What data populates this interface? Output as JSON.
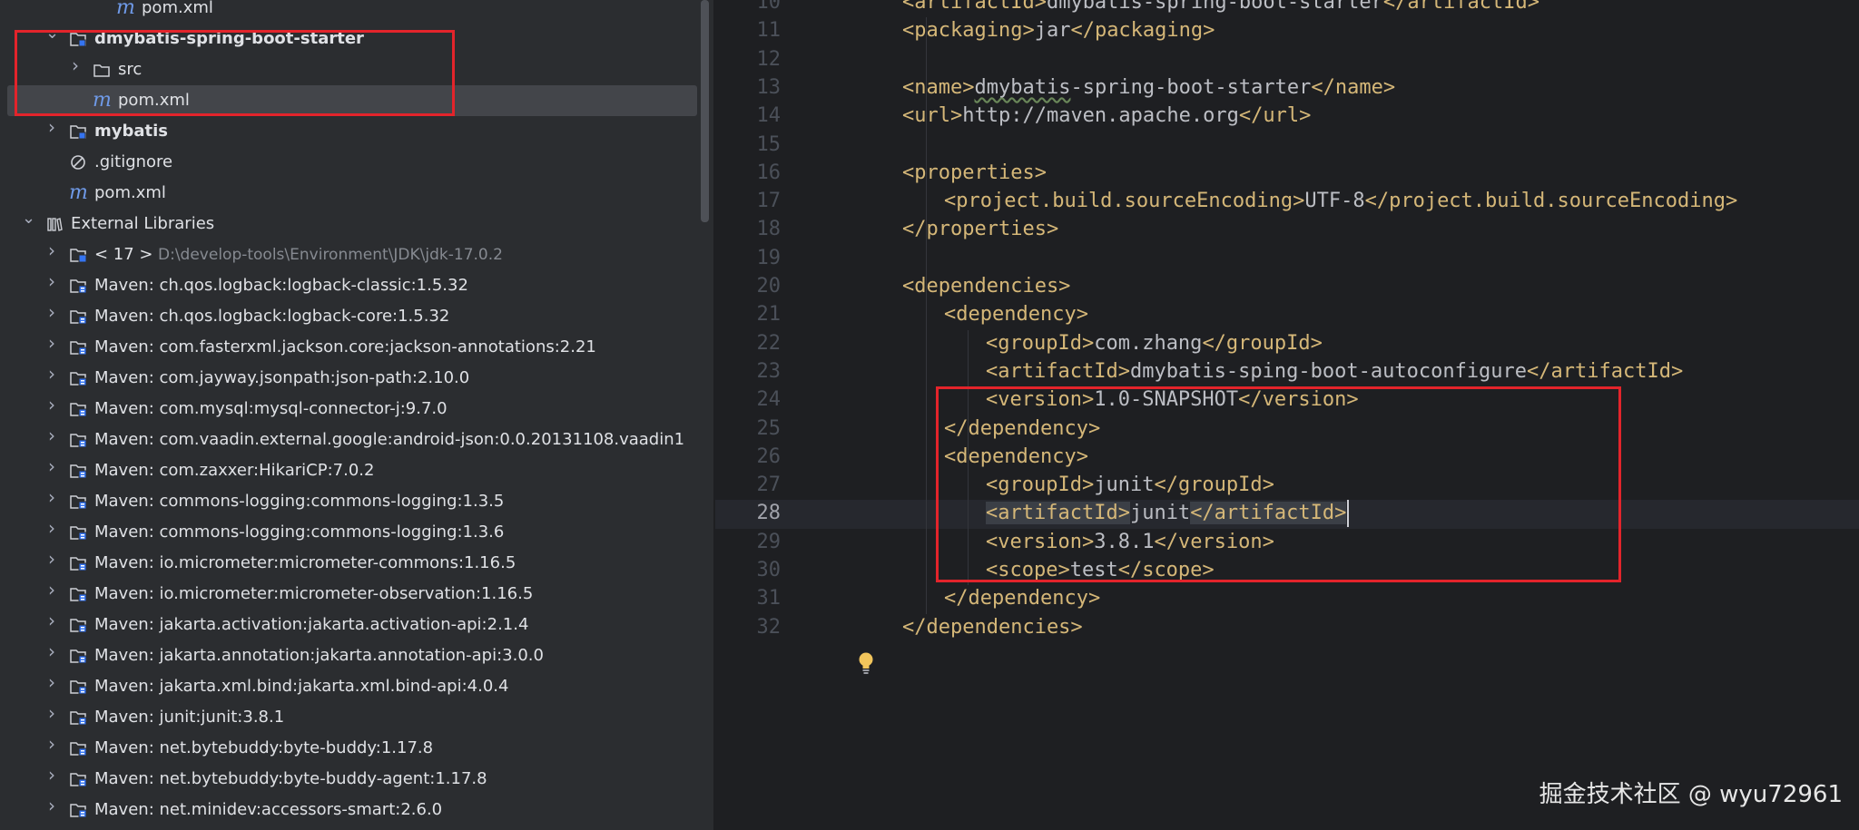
{
  "project_tree": {
    "rows": [
      {
        "label": "pom.xml",
        "icon": "maven-file-icon",
        "indent": 3,
        "arrow": "",
        "bold": false
      },
      {
        "label": "dmybatis-spring-boot-starter",
        "icon": "module-folder-icon",
        "indent": 1,
        "arrow": "expanded",
        "bold": true
      },
      {
        "label": "src",
        "icon": "folder-icon",
        "indent": 2,
        "arrow": "collapsed",
        "bold": false
      },
      {
        "label": "pom.xml",
        "icon": "maven-file-icon",
        "indent": 2,
        "arrow": "",
        "bold": false,
        "selected": true
      },
      {
        "label": "mybatis",
        "icon": "module-folder-icon",
        "indent": 1,
        "arrow": "collapsed",
        "bold": true
      },
      {
        "label": ".gitignore",
        "icon": "ignore-file-icon",
        "indent": 1,
        "arrow": "",
        "bold": false
      },
      {
        "label": "pom.xml",
        "icon": "maven-file-icon",
        "indent": 1,
        "arrow": "",
        "bold": false
      },
      {
        "label": "External Libraries",
        "icon": "library-icon",
        "indent": 0,
        "arrow": "expanded",
        "bold": false
      },
      {
        "label": "< 17 >",
        "path": "D:\\develop-tools\\Environment\\JDK\\jdk-17.0.2",
        "icon": "jdk-icon",
        "indent": 1,
        "arrow": "collapsed",
        "bold": false
      },
      {
        "label": "Maven: ch.qos.logback:logback-classic:1.5.32",
        "icon": "library-jar-icon",
        "indent": 1,
        "arrow": "collapsed",
        "bold": false
      },
      {
        "label": "Maven: ch.qos.logback:logback-core:1.5.32",
        "icon": "library-jar-icon",
        "indent": 1,
        "arrow": "collapsed",
        "bold": false
      },
      {
        "label": "Maven: com.fasterxml.jackson.core:jackson-annotations:2.21",
        "icon": "library-jar-icon",
        "indent": 1,
        "arrow": "collapsed",
        "bold": false
      },
      {
        "label": "Maven: com.jayway.jsonpath:json-path:2.10.0",
        "icon": "library-jar-icon",
        "indent": 1,
        "arrow": "collapsed",
        "bold": false
      },
      {
        "label": "Maven: com.mysql:mysql-connector-j:9.7.0",
        "icon": "library-jar-icon",
        "indent": 1,
        "arrow": "collapsed",
        "bold": false
      },
      {
        "label": "Maven: com.vaadin.external.google:android-json:0.0.20131108.vaadin1",
        "icon": "library-jar-icon",
        "indent": 1,
        "arrow": "collapsed",
        "bold": false
      },
      {
        "label": "Maven: com.zaxxer:HikariCP:7.0.2",
        "icon": "library-jar-icon",
        "indent": 1,
        "arrow": "collapsed",
        "bold": false
      },
      {
        "label": "Maven: commons-logging:commons-logging:1.3.5",
        "icon": "library-jar-icon",
        "indent": 1,
        "arrow": "collapsed",
        "bold": false
      },
      {
        "label": "Maven: commons-logging:commons-logging:1.3.6",
        "icon": "library-jar-icon",
        "indent": 1,
        "arrow": "collapsed",
        "bold": false
      },
      {
        "label": "Maven: io.micrometer:micrometer-commons:1.16.5",
        "icon": "library-jar-icon",
        "indent": 1,
        "arrow": "collapsed",
        "bold": false
      },
      {
        "label": "Maven: io.micrometer:micrometer-observation:1.16.5",
        "icon": "library-jar-icon",
        "indent": 1,
        "arrow": "collapsed",
        "bold": false
      },
      {
        "label": "Maven: jakarta.activation:jakarta.activation-api:2.1.4",
        "icon": "library-jar-icon",
        "indent": 1,
        "arrow": "collapsed",
        "bold": false
      },
      {
        "label": "Maven: jakarta.annotation:jakarta.annotation-api:3.0.0",
        "icon": "library-jar-icon",
        "indent": 1,
        "arrow": "collapsed",
        "bold": false
      },
      {
        "label": "Maven: jakarta.xml.bind:jakarta.xml.bind-api:4.0.4",
        "icon": "library-jar-icon",
        "indent": 1,
        "arrow": "collapsed",
        "bold": false
      },
      {
        "label": "Maven: junit:junit:3.8.1",
        "icon": "library-jar-icon",
        "indent": 1,
        "arrow": "collapsed",
        "bold": false
      },
      {
        "label": "Maven: net.bytebuddy:byte-buddy:1.17.8",
        "icon": "library-jar-icon",
        "indent": 1,
        "arrow": "collapsed",
        "bold": false
      },
      {
        "label": "Maven: net.bytebuddy:byte-buddy-agent:1.17.8",
        "icon": "library-jar-icon",
        "indent": 1,
        "arrow": "collapsed",
        "bold": false
      },
      {
        "label": "Maven: net.minidev:accessors-smart:2.6.0",
        "icon": "library-jar-icon",
        "indent": 1,
        "arrow": "collapsed",
        "bold": false
      }
    ]
  },
  "editor": {
    "current_line": "28",
    "lines": [
      {
        "n": "10",
        "depth": 1,
        "parts": [
          [
            "t",
            "<artifactId>"
          ],
          [
            "x",
            "dmybatis-spring-boot-starter"
          ],
          [
            "t",
            "</artifactId>"
          ]
        ]
      },
      {
        "n": "11",
        "depth": 1,
        "parts": [
          [
            "t",
            "<packaging>"
          ],
          [
            "x",
            "jar"
          ],
          [
            "t",
            "</packaging>"
          ]
        ]
      },
      {
        "n": "12",
        "depth": 1,
        "parts": []
      },
      {
        "n": "13",
        "depth": 1,
        "parts": [
          [
            "t",
            "<name>"
          ],
          [
            "xw",
            "dmybatis"
          ],
          [
            "x",
            "-spring-boot-starter"
          ],
          [
            "t",
            "</name>"
          ]
        ]
      },
      {
        "n": "14",
        "depth": 1,
        "parts": [
          [
            "t",
            "<url>"
          ],
          [
            "x",
            "http://maven.apache.org"
          ],
          [
            "t",
            "</url>"
          ]
        ]
      },
      {
        "n": "15",
        "depth": 1,
        "parts": []
      },
      {
        "n": "16",
        "depth": 1,
        "parts": [
          [
            "t",
            "<properties>"
          ]
        ]
      },
      {
        "n": "17",
        "depth": 2,
        "parts": [
          [
            "t",
            "<project.build.sourceEncoding>"
          ],
          [
            "x",
            "UTF-8"
          ],
          [
            "t",
            "</project.build.sourceEncoding>"
          ]
        ]
      },
      {
        "n": "18",
        "depth": 1,
        "parts": [
          [
            "t",
            "</properties>"
          ]
        ]
      },
      {
        "n": "19",
        "depth": 1,
        "parts": []
      },
      {
        "n": "20",
        "depth": 1,
        "parts": [
          [
            "t",
            "<dependencies>"
          ]
        ]
      },
      {
        "n": "21",
        "depth": 2,
        "parts": [
          [
            "t",
            "<dependency>"
          ]
        ]
      },
      {
        "n": "22",
        "depth": 3,
        "parts": [
          [
            "t",
            "<groupId>"
          ],
          [
            "x",
            "com.zhang"
          ],
          [
            "t",
            "</groupId>"
          ]
        ]
      },
      {
        "n": "23",
        "depth": 3,
        "parts": [
          [
            "t",
            "<artifactId>"
          ],
          [
            "x",
            "dmybatis-sping-boot-autoconfigure"
          ],
          [
            "t",
            "</artifactId>"
          ]
        ]
      },
      {
        "n": "24",
        "depth": 3,
        "parts": [
          [
            "t",
            "<version>"
          ],
          [
            "x",
            "1.0-SNAPSHOT"
          ],
          [
            "t",
            "</version>"
          ]
        ]
      },
      {
        "n": "25",
        "depth": 2,
        "parts": [
          [
            "t",
            "</dependency>"
          ]
        ]
      },
      {
        "n": "26",
        "depth": 2,
        "parts": [
          [
            "t",
            "<dependency>"
          ]
        ]
      },
      {
        "n": "27",
        "depth": 3,
        "parts": [
          [
            "t",
            "<groupId>"
          ],
          [
            "x",
            "junit"
          ],
          [
            "t",
            "</groupId>"
          ]
        ]
      },
      {
        "n": "28",
        "depth": 3,
        "parts": [
          [
            "th",
            "<artifactId>"
          ],
          [
            "x",
            "junit"
          ],
          [
            "th",
            "</artifactId>"
          ]
        ]
      },
      {
        "n": "29",
        "depth": 3,
        "parts": [
          [
            "t",
            "<version>"
          ],
          [
            "x",
            "3.8.1"
          ],
          [
            "t",
            "</version>"
          ]
        ]
      },
      {
        "n": "30",
        "depth": 3,
        "parts": [
          [
            "t",
            "<scope>"
          ],
          [
            "x",
            "test"
          ],
          [
            "t",
            "</scope>"
          ]
        ]
      },
      {
        "n": "31",
        "depth": 2,
        "parts": [
          [
            "t",
            "</dependency>"
          ]
        ]
      },
      {
        "n": "32",
        "depth": 1,
        "parts": [
          [
            "t",
            "</dependencies>"
          ]
        ]
      }
    ]
  },
  "watermark": "掘金技术社区 @ wyu72961",
  "colors": {
    "tag": "#d5b778",
    "text": "#bcbec4",
    "annotation_box": "#e3242b",
    "maven_icon": "#6f9ae8",
    "panel_bg": "#2b2d30",
    "editor_bg": "#1e1f22"
  }
}
